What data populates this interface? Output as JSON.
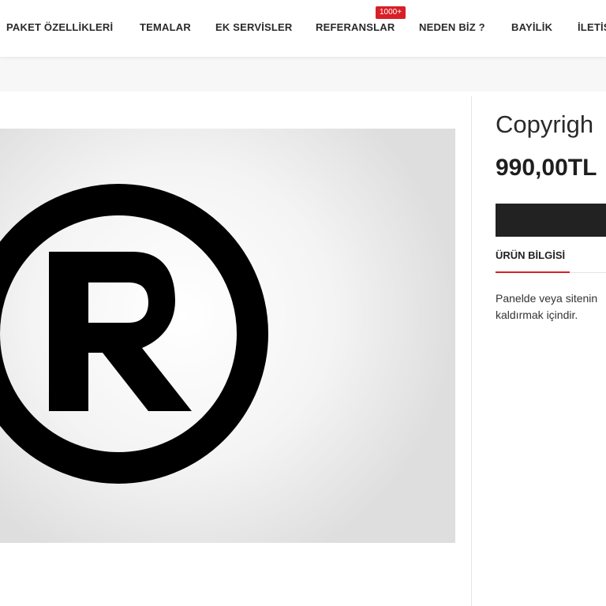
{
  "nav": {
    "items": [
      "PAKET ÖZELLİKLERİ",
      "TEMALAR",
      "EK SERVİSLER",
      "REFERANSLAR",
      "NEDEN BİZ ?",
      "BAYİLİK",
      "İLETİŞ"
    ],
    "badge": "1000+"
  },
  "product": {
    "title": "Copyrigh",
    "price": "990,00TL",
    "image_icon": "registered-trademark-icon",
    "tab_label": "ÜRÜN BİLGİSİ",
    "description_lines": [
      "Panelde veya sitenin",
      "kaldırmak içindir."
    ]
  },
  "colors": {
    "accent": "#d81f26",
    "button": "#222222"
  }
}
